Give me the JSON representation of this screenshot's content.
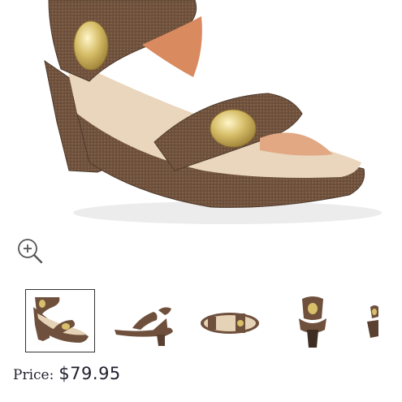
{
  "product": {
    "main_image_alt": "bronze-sandal-main-image",
    "colors": {
      "bronze": "#7a5a43",
      "bronze_dark": "#5e4332",
      "sole": "#e5cfb3",
      "gold": "#d8c06a"
    }
  },
  "gallery": {
    "zoom_icon": "zoom-in-icon",
    "thumbnails": [
      {
        "view": "front-angle",
        "selected": true
      },
      {
        "view": "side"
      },
      {
        "view": "top"
      },
      {
        "view": "back"
      },
      {
        "view": "partial"
      }
    ]
  },
  "price": {
    "label": "Price:",
    "value": "$79.95"
  }
}
